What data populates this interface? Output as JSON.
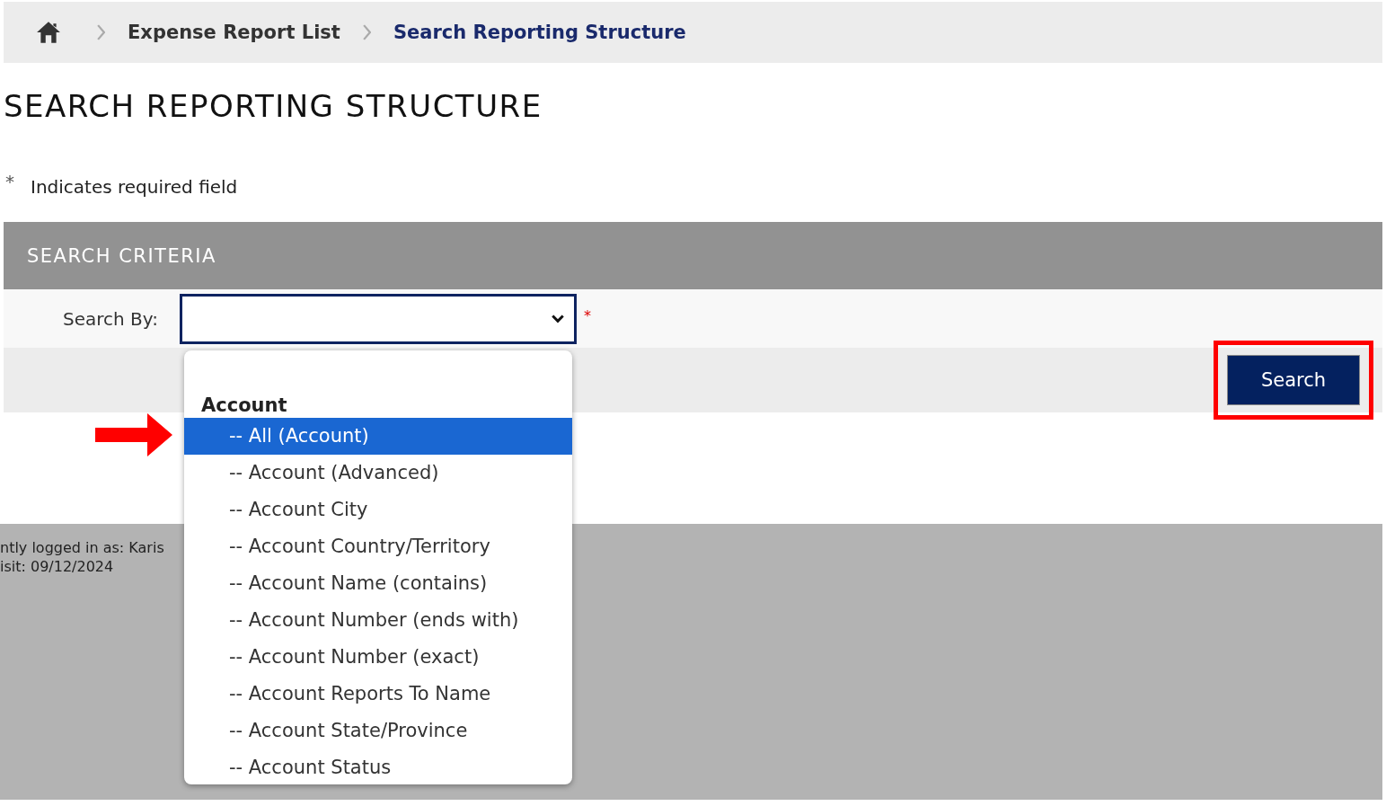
{
  "breadcrumb": [
    {
      "label": "Expense Report List",
      "current": false
    },
    {
      "label": "Search Reporting Structure",
      "current": true
    }
  ],
  "page_title": "SEARCH REPORTING STRUCTURE",
  "required_note": {
    "mark": "*",
    "text": "Indicates required field"
  },
  "search_criteria": {
    "title": "SEARCH CRITERIA",
    "field_label": "Search By:",
    "required_mark": "*",
    "button": "Search"
  },
  "dropdown": {
    "group": "Account",
    "options": [
      {
        "label": "-- All (Account)",
        "selected": true
      },
      {
        "label": "-- Account (Advanced)",
        "selected": false
      },
      {
        "label": "-- Account City",
        "selected": false
      },
      {
        "label": "-- Account Country/Territory",
        "selected": false
      },
      {
        "label": "-- Account Name (contains)",
        "selected": false
      },
      {
        "label": "-- Account Number (ends with)",
        "selected": false
      },
      {
        "label": "-- Account Number (exact)",
        "selected": false
      },
      {
        "label": "-- Account Reports To Name",
        "selected": false
      },
      {
        "label": "-- Account State/Province",
        "selected": false
      },
      {
        "label": "-- Account Status",
        "selected": false
      }
    ]
  },
  "footer": {
    "lines": [
      "ntly logged in as: Karis",
      "isit: 09/12/2024"
    ]
  }
}
